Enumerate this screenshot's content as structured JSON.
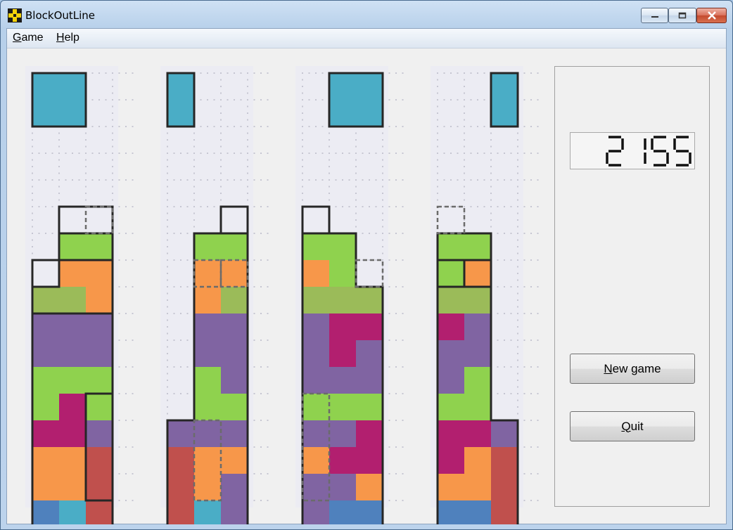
{
  "window": {
    "title": "BlockOutLine"
  },
  "menu": {
    "items": [
      "Game",
      "Help"
    ]
  },
  "score": {
    "value": "2155"
  },
  "buttons": {
    "new_game": "New game",
    "quit": "Quit"
  },
  "colors": {
    "cyan": "#4aadc6",
    "green": "#8fd24e",
    "orange": "#f7974a",
    "olive": "#9bbb59",
    "purple": "#8064a2",
    "magenta": "#b21f6f",
    "red": "#c0504d",
    "blue": "#4f81bd",
    "board_bg": "#ececf3",
    "grid_dot": "#c6c6d2",
    "outline": "#262626",
    "dash": "#6b6b6b"
  },
  "game": {
    "cols": 3,
    "rows": 16,
    "boards": [
      {
        "piece": {
          "col": 0,
          "row": 0,
          "w": 2,
          "h": 2,
          "color": "cyan"
        },
        "cells": [
          ".........",
          ".........",
          ".........",
          ".........",
          ".........",
          ".........",
          ".GG",
          ".OO",
          "LLO",
          "PPP",
          "PPP",
          "GGG",
          "GMG",
          "MMP",
          "OOR",
          "OOR",
          "BCR"
        ],
        "boxes": [
          [
            1,
            5,
            2,
            2
          ],
          [
            0,
            7,
            1,
            1
          ],
          [
            2,
            12,
            1,
            4
          ],
          [
            0,
            7,
            3,
            2
          ]
        ],
        "dashed": [
          [
            2,
            5,
            1,
            1
          ]
        ]
      },
      {
        "piece": {
          "col": 0,
          "row": 0,
          "w": 1,
          "h": 2,
          "color": "cyan"
        },
        "cells": [
          ".........",
          ".........",
          ".........",
          ".........",
          ".........",
          ".........",
          ".GG",
          ".OO",
          ".OL",
          ".PP",
          ".PP",
          ".GP",
          ".GG",
          "PPP",
          "ROO",
          "ROP",
          "RCP"
        ],
        "boxes": [
          [
            2,
            5,
            1,
            1
          ]
        ],
        "dashed": [
          [
            1,
            7,
            1,
            1
          ],
          [
            2,
            7,
            1,
            1
          ],
          [
            1,
            13,
            1,
            3
          ]
        ]
      },
      {
        "piece": {
          "col": 1,
          "row": 0,
          "w": 2,
          "h": 2,
          "color": "cyan"
        },
        "cells": [
          ".........",
          ".........",
          ".........",
          ".........",
          ".........",
          ".........",
          "GG.",
          "OG.",
          "LLL",
          "PMM",
          "PMP",
          "PPP",
          "GGG",
          "PPM",
          "OMM",
          "PPO",
          "PBB"
        ],
        "boxes": [
          [
            0,
            5,
            1,
            1
          ]
        ],
        "dashed": [
          [
            2,
            7,
            1,
            1
          ],
          [
            0,
            12,
            1,
            4
          ]
        ]
      },
      {
        "piece": {
          "col": 2,
          "row": 0,
          "w": 1,
          "h": 2,
          "color": "cyan"
        },
        "cells": [
          ".........",
          ".........",
          ".........",
          ".........",
          ".........",
          ".........",
          "GG.",
          "GO.",
          "LL.",
          "MP.",
          "PP.",
          "PG.",
          "GG.",
          "MMP",
          "MOR",
          "OOR",
          "BBR"
        ],
        "boxes": [
          [
            0,
            7,
            1,
            1
          ],
          [
            1,
            7,
            1,
            1
          ]
        ],
        "dashed": [
          [
            0,
            5,
            1,
            1
          ]
        ]
      }
    ]
  }
}
